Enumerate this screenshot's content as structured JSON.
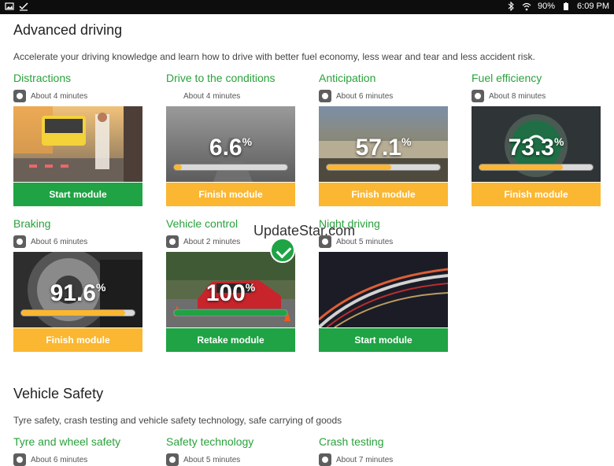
{
  "statusbar": {
    "battery": "90%",
    "time": "6:09 PM"
  },
  "sections": [
    {
      "title": "Advanced driving",
      "description": "Accelerate your driving knowledge and learn how to drive with better fuel economy, less wear and tear and less accident risk."
    },
    {
      "title": "Vehicle Safety",
      "description": "Tyre safety, crash testing and vehicle safety technology, safe carrying of goods"
    }
  ],
  "modules": [
    {
      "title": "Distractions",
      "duration": "About 4 minutes",
      "progress": null,
      "button": "Start module",
      "button_color": "#1fa344"
    },
    {
      "title": "Drive to the conditions",
      "duration": "About 4 minutes",
      "progress": "6.6",
      "progress_fraction": 0.066,
      "button": "Finish module",
      "button_color": "#fbb731"
    },
    {
      "title": "Anticipation",
      "duration": "About 6 minutes",
      "progress": "57.1",
      "progress_fraction": 0.571,
      "button": "Finish module",
      "button_color": "#fbb731"
    },
    {
      "title": "Fuel efficiency",
      "duration": "About 8 minutes",
      "progress": "73.3",
      "progress_fraction": 0.733,
      "button": "Finish module",
      "button_color": "#fbb731"
    },
    {
      "title": "Braking",
      "duration": "About 6 minutes",
      "progress": "91.6",
      "progress_fraction": 0.916,
      "button": "Finish module",
      "button_color": "#fbb731"
    },
    {
      "title": "Vehicle control",
      "duration": "About 2 minutes",
      "progress": "100",
      "progress_fraction": 1.0,
      "completed": true,
      "button": "Retake module",
      "button_color": "#1fa344"
    },
    {
      "title": "Night driving",
      "duration": "About 5 minutes",
      "progress": null,
      "button": "Start module",
      "button_color": "#1fa344"
    },
    {
      "title": "Tyre and wheel safety",
      "duration": "About 6 minutes"
    },
    {
      "title": "Safety technology",
      "duration": "About 5 minutes"
    },
    {
      "title": "Crash testing",
      "duration": "About 7 minutes"
    }
  ],
  "percent_symbol": "%",
  "watermark": "UpdateStar.com"
}
